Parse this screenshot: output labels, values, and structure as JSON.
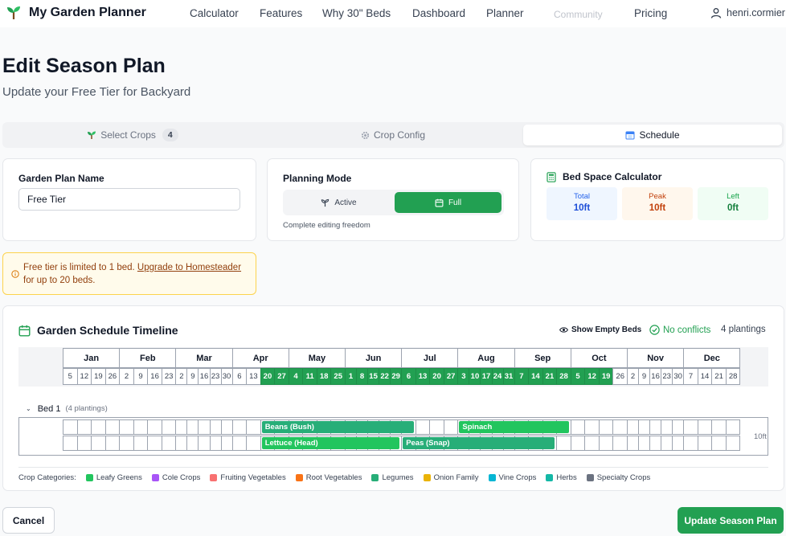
{
  "header": {
    "brand": "My Garden Planner",
    "nav": [
      "Calculator",
      "Features",
      "Why 30\" Beds",
      "Dashboard",
      "Planner",
      "Community",
      "Pricing"
    ],
    "user": "henri.cormier"
  },
  "page": {
    "title": "Edit Season Plan",
    "subtitle": "Update your Free Tier for Backyard"
  },
  "tabs": [
    {
      "label": "Select Crops",
      "badge": "4",
      "icon": "seedling-icon"
    },
    {
      "label": "Crop Config",
      "icon": "gear-icon"
    },
    {
      "label": "Schedule",
      "icon": "calendar-icon",
      "active": true
    }
  ],
  "plan_name": {
    "label": "Garden Plan Name",
    "value": "Free Tier"
  },
  "planning_mode": {
    "label": "Planning Mode",
    "options": [
      "Active",
      "Full"
    ],
    "selected": "Full",
    "description": "Complete editing freedom"
  },
  "bed_space": {
    "title": "Bed Space Calculator",
    "stats": [
      {
        "label": "Total",
        "value": "10ft",
        "bg": "#eff6ff",
        "label_color": "#2563eb",
        "value_color": "#1d4ed8"
      },
      {
        "label": "Peak",
        "value": "10ft",
        "bg": "#fff7ed",
        "label_color": "#c2410c",
        "value_color": "#c2410c"
      },
      {
        "label": "Left",
        "value": "0ft",
        "bg": "#f0fdf4",
        "label_color": "#16a34a",
        "value_color": "#15803d"
      }
    ]
  },
  "alert": {
    "before": "Free tier is limited to 1 bed. ",
    "link": "Upgrade to Homesteader",
    "after": " for up to 20 beds."
  },
  "timeline": {
    "title": "Garden Schedule Timeline",
    "show_empty": "Show Empty Beds",
    "conflicts": "No conflicts",
    "plantings": "4 plantings",
    "months": [
      {
        "name": "Jan",
        "weeks": [
          "5",
          "12",
          "19",
          "26"
        ]
      },
      {
        "name": "Feb",
        "weeks": [
          "2",
          "9",
          "16",
          "23"
        ]
      },
      {
        "name": "Mar",
        "weeks": [
          "2",
          "9",
          "16",
          "23",
          "30"
        ]
      },
      {
        "name": "Apr",
        "weeks": [
          "6",
          "13",
          "20",
          "27"
        ]
      },
      {
        "name": "May",
        "weeks": [
          "4",
          "11",
          "18",
          "25"
        ]
      },
      {
        "name": "Jun",
        "weeks": [
          "1",
          "8",
          "15",
          "22",
          "29"
        ]
      },
      {
        "name": "Jul",
        "weeks": [
          "6",
          "13",
          "20",
          "27"
        ]
      },
      {
        "name": "Aug",
        "weeks": [
          "3",
          "10",
          "17",
          "24",
          "31"
        ]
      },
      {
        "name": "Sep",
        "weeks": [
          "7",
          "14",
          "21",
          "28"
        ]
      },
      {
        "name": "Oct",
        "weeks": [
          "5",
          "12",
          "19",
          "26"
        ]
      },
      {
        "name": "Nov",
        "weeks": [
          "2",
          "9",
          "16",
          "23",
          "30"
        ]
      },
      {
        "name": "Dec",
        "weeks": [
          "7",
          "14",
          "21",
          "28"
        ]
      }
    ],
    "highlight_range": [
      "Apr 20",
      "Oct 19"
    ],
    "bed": {
      "name": "Bed 1",
      "count": "(4 plantings)",
      "length": "10ft",
      "plantings": [
        {
          "name": "Beans (Bush)",
          "lane": 0,
          "start": "Apr 20",
          "end": "Jul 6",
          "color": "#27ae78"
        },
        {
          "name": "Spinach",
          "lane": 0,
          "start": "Aug 3",
          "end": "Sep 28",
          "color": "#22c55e"
        },
        {
          "name": "Lettuce (Head)",
          "lane": 1,
          "start": "Apr 20",
          "end": "Jun 29",
          "color": "#22c55e"
        },
        {
          "name": "Peas (Snap)",
          "lane": 1,
          "start": "Jul 6",
          "end": "Sep 21",
          "color": "#27ae78"
        }
      ]
    }
  },
  "legend": {
    "title": "Crop Categories:",
    "items": [
      {
        "name": "Leafy Greens",
        "color": "#22c55e"
      },
      {
        "name": "Cole Crops",
        "color": "#a855f7"
      },
      {
        "name": "Fruiting Vegetables",
        "color": "#f87171"
      },
      {
        "name": "Root Vegetables",
        "color": "#f97316"
      },
      {
        "name": "Legumes",
        "color": "#27ae78"
      },
      {
        "name": "Onion Family",
        "color": "#eab308"
      },
      {
        "name": "Vine Crops",
        "color": "#06b6d4"
      },
      {
        "name": "Herbs",
        "color": "#14b8a6"
      },
      {
        "name": "Specialty Crops",
        "color": "#6b7280"
      }
    ]
  },
  "actions": {
    "cancel": "Cancel",
    "submit": "Update Season Plan"
  }
}
